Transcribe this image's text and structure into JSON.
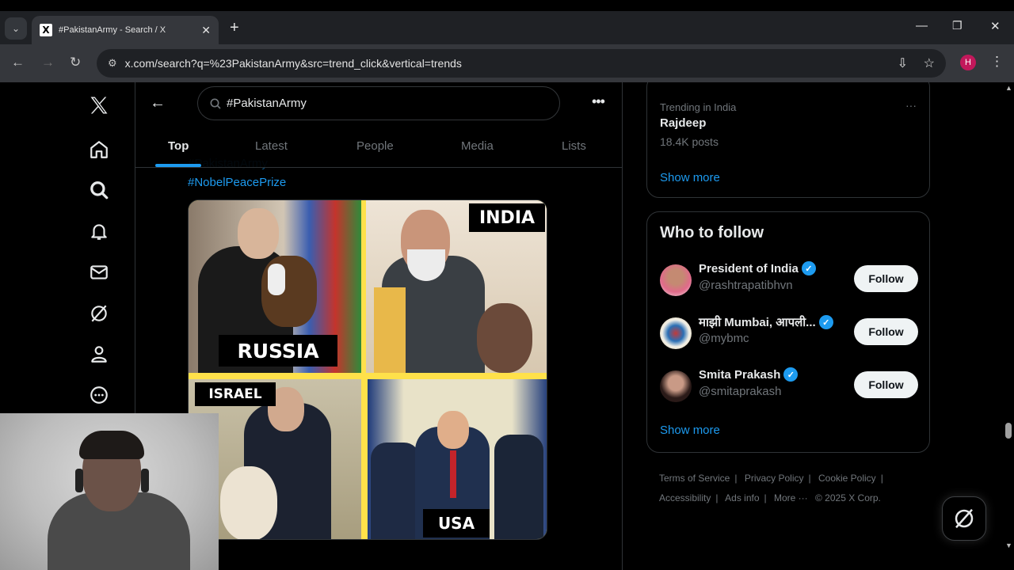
{
  "browser": {
    "tab_title": "#PakistanArmy - Search / X",
    "url": "x.com/search?q=%23PakistanArmy&src=trend_click&vertical=trends",
    "profile_initial": "H"
  },
  "search": {
    "query": "#PakistanArmy"
  },
  "tabs": [
    "Top",
    "Latest",
    "People",
    "Media",
    "Lists"
  ],
  "tweet": {
    "hashtags": [
      "#PakistanArmy",
      "#NobelPeacePrize"
    ],
    "image_labels": {
      "russia": "RUSSIA",
      "india": "INDIA",
      "israel": "ISRAEL",
      "usa": "USA"
    }
  },
  "trending": {
    "context": "Trending in India",
    "topic": "Rajdeep",
    "posts": "18.4K posts",
    "show_more": "Show more"
  },
  "who_to_follow": {
    "title": "Who to follow",
    "accounts": [
      {
        "name": "President of India",
        "handle": "@rashtrapatibhvn",
        "button": "Follow"
      },
      {
        "name": "माझी Mumbai, आपली...",
        "handle": "@mybmc",
        "button": "Follow"
      },
      {
        "name": "Smita Prakash",
        "handle": "@smitaprakash",
        "button": "Follow"
      }
    ],
    "show_more": "Show more"
  },
  "footer": {
    "links": [
      "Terms of Service",
      "Privacy Policy",
      "Cookie Policy",
      "Accessibility",
      "Ads info",
      "More ···"
    ],
    "copyright": "© 2025 X Corp."
  },
  "colors": {
    "accent": "#1d9bf0",
    "background": "#000000",
    "border": "#2f3336"
  }
}
